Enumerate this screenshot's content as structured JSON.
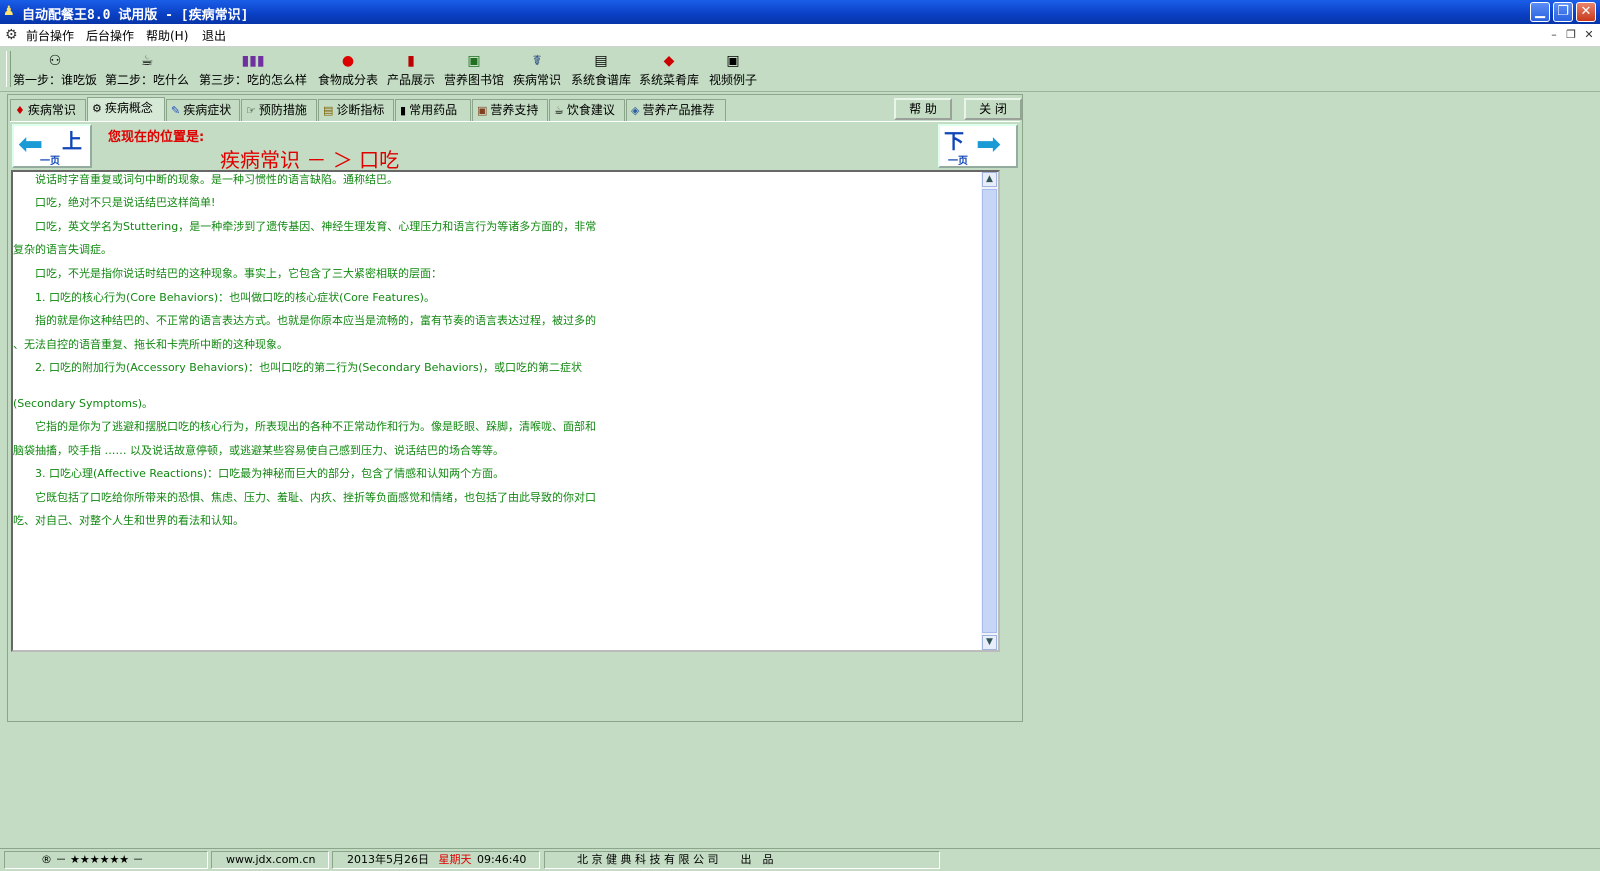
{
  "window": {
    "title": "自动配餐王8.0 试用版 - [疾病常识]",
    "minimize_glyph": "▁",
    "restore_glyph": "❐",
    "close_glyph": "✕"
  },
  "menubar": {
    "items": [
      "前台操作",
      "后台操作",
      "帮助(H)",
      "退出"
    ],
    "mdi_minimize": "–",
    "mdi_restore": "❐",
    "mdi_close": "✕"
  },
  "toolbar": {
    "buttons": [
      {
        "label": "第一步：谁吃饭",
        "icon": "person-icon"
      },
      {
        "label": "第二步：吃什么",
        "icon": "pot-icon"
      },
      {
        "label": "第三步：吃的怎么样",
        "icon": "bars-icon"
      },
      {
        "label": "食物成分表",
        "icon": "apple-icon"
      },
      {
        "label": "产品展示",
        "icon": "bottle-icon"
      },
      {
        "label": "营养图书馆",
        "icon": "book-icon"
      },
      {
        "label": "疾病常识",
        "icon": "medical-icon"
      },
      {
        "label": "系统食谱库",
        "icon": "recipe-icon"
      },
      {
        "label": "系统菜肴库",
        "icon": "dish-icon"
      },
      {
        "label": "视频例子",
        "icon": "video-icon"
      }
    ]
  },
  "tabs": [
    {
      "label": "疾病常识",
      "icon": "book-icon",
      "active": false
    },
    {
      "label": "疾病概念",
      "icon": "concept-icon",
      "active": true
    },
    {
      "label": "疾病症状",
      "icon": "pen-icon",
      "active": false
    },
    {
      "label": "预防措施",
      "icon": "hand-icon",
      "active": false
    },
    {
      "label": "诊断指标",
      "icon": "books-icon",
      "active": false
    },
    {
      "label": "常用药品",
      "icon": "pill-icon",
      "active": false
    },
    {
      "label": "营养支持",
      "icon": "box-icon",
      "active": false
    },
    {
      "label": "饮食建议",
      "icon": "cup-icon",
      "active": false
    },
    {
      "label": "营养产品推荐",
      "icon": "cube-icon",
      "active": false
    }
  ],
  "actions": {
    "help_label": "帮 助",
    "close_label": "关 闭"
  },
  "nav": {
    "prev_big": "上",
    "prev_small": "一页",
    "next_big": "下",
    "next_small": "一页",
    "location_label": "您现在的位置是:",
    "location_path": "疾病常识 － ＞ 口吃"
  },
  "content": {
    "lines": [
      "　　说话时字音重复或词句中断的现象。是一种习惯性的语言缺陷。通称结巴。",
      "　　口吃，绝对不只是说话结巴这样简单!",
      "　　口吃，英文学名为Stuttering，是一种牵涉到了遗传基因、神经生理发育、心理压力和语言行为等诸多方面的，非常",
      "复杂的语言失调症。",
      "　　口吃，不光是指你说话时结巴的这种现象。事实上，它包含了三大紧密相联的层面：",
      "　　1. 口吃的核心行为(Core Behaviors)：也叫做口吃的核心症状(Core Features)。",
      "　　指的就是你这种结巴的、不正常的语言表达方式。也就是你原本应当是流畅的，富有节奏的语言表达过程，被过多的",
      "、无法自控的语音重复、拖长和卡壳所中断的这种现象。",
      "　　2. 口吃的附加行为(Accessory Behaviors)：也叫口吃的第二行为(Secondary Behaviors)，或口吃的第二症状",
      "",
      "(Secondary Symptoms)。",
      "　　它指的是你为了逃避和摆脱口吃的核心行为，所表现出的各种不正常动作和行为。像是眨眼、跺脚，清喉咙、面部和",
      "脑袋抽搐，咬手指 …… 以及说话故意停顿，或逃避某些容易使自己感到压力、说话结巴的场合等等。",
      "　　3. 口吃心理(Affective Reactions)：口吃最为神秘而巨大的部分，包含了情感和认知两个方面。",
      "　　它既包括了口吃给你所带来的恐惧、焦虑、压力、羞耻、内疚、挫折等负面感觉和情绪，也包括了由此导致的你对口",
      "吃、对自己、对整个人生和世界的看法和认知。"
    ]
  },
  "status": {
    "rating": "®  － ★★★★★★ －",
    "website": "www.jdx.com.cn",
    "date": "2013年5月26日",
    "weekday": "星期天",
    "time": "09:46:40",
    "company": "北 京 健 典 科 技 有 限 公 司　　出　品"
  },
  "colors": {
    "background": "#c3dcc3",
    "title_blue": "#0a3fc4",
    "text_green": "#118811",
    "location_red": "#e00000"
  }
}
